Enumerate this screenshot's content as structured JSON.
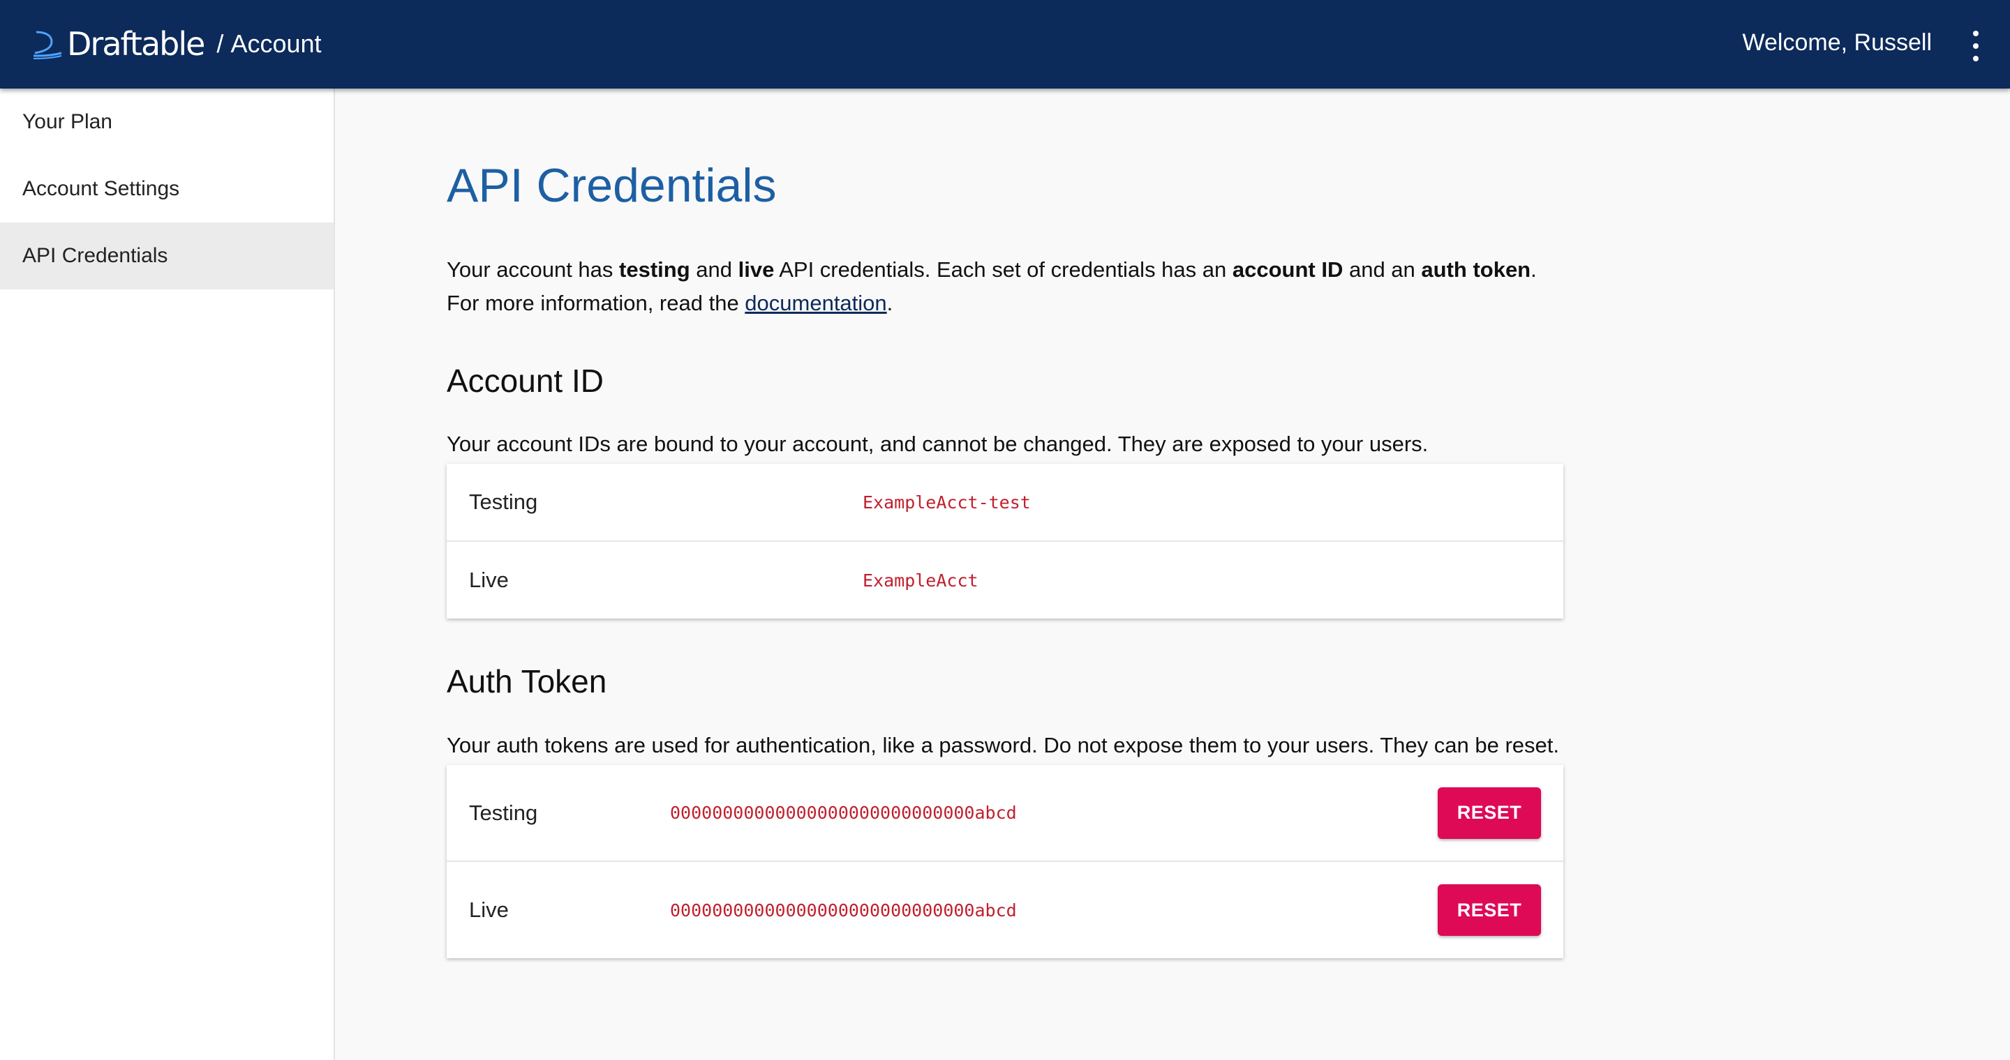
{
  "header": {
    "brand": "Draftable",
    "separator": "/",
    "section": "Account",
    "welcome": "Welcome, Russell",
    "menu_icon": "more-vert-icon",
    "logo_icon": "draftable-logo-icon",
    "background_color": "#0c2a5a"
  },
  "sidebar": {
    "items": [
      {
        "label": "Your Plan"
      },
      {
        "label": "Account Settings"
      },
      {
        "label": "API Credentials"
      }
    ],
    "active": "API Credentials"
  },
  "main": {
    "title": "API Credentials",
    "intro": {
      "t1": "Your account has ",
      "b1": "testing",
      "t2": " and ",
      "b2": "live",
      "t3": " API credentials. Each set of credentials has an ",
      "b3": "account ID",
      "t4": " and an ",
      "b4": "auth token",
      "t5": ".",
      "line2_pre": "For more information, read the ",
      "link": "documentation",
      "line2_post": "."
    },
    "account_id": {
      "heading": "Account ID",
      "description": "Your account IDs are bound to your account, and cannot be changed. They are exposed to your users.",
      "rows": [
        {
          "label": "Testing",
          "value": "ExampleAcct-test"
        },
        {
          "label": "Live",
          "value": "ExampleAcct"
        }
      ]
    },
    "auth_token": {
      "heading": "Auth Token",
      "description": "Your auth tokens are used for authentication, like a password. Do not expose them to your users. They can be reset.",
      "rows": [
        {
          "label": "Testing",
          "value": "00000000000000000000000000000abcd",
          "button": "RESET"
        },
        {
          "label": "Live",
          "value": "00000000000000000000000000000abcd",
          "button": "RESET"
        }
      ]
    }
  },
  "colors": {
    "title": "#1d5fa3",
    "code": "#c0202e",
    "reset_button": "#de0a56"
  }
}
